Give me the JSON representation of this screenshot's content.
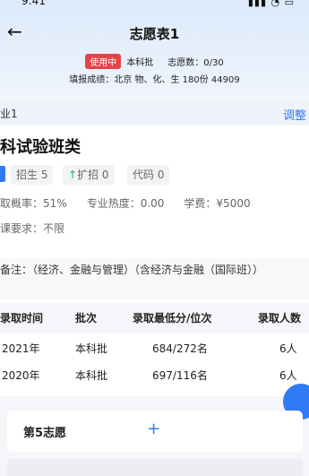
{
  "status": {
    "time": "9:41",
    "icons": "▮▮▮ ◔ ▭"
  },
  "header": {
    "back_icon": "arrow-left-icon",
    "title": "志愿表1",
    "badge": "使用中",
    "batch": "本科批",
    "count_label": "志愿数：0/30",
    "score_line": "填报成绩：北京   物、化、生  180份  44909"
  },
  "card": {
    "crumb": "业1",
    "adjust": "调整",
    "school": "科试验班类",
    "tags": {
      "enroll": "招生 5",
      "expand_arrow": "↑",
      "expand": "扩招 0",
      "code": "代码 0"
    },
    "prob_line": {
      "prob": "取概率：51%",
      "heat": "专业热度：0.00",
      "fee": "学费：¥5000"
    },
    "subject_req": "课要求：不限",
    "remark": "备注：（经济、金融与管理）（含经济与金融（国际班））"
  },
  "table": {
    "headers": [
      "录取时间",
      "批次",
      "录取最低分/位次",
      "录取人数"
    ],
    "rows": [
      [
        "2021年",
        "本科批",
        "684/272名",
        "6人"
      ],
      [
        "2020年",
        "本科批",
        "697/116名",
        "6人"
      ]
    ]
  },
  "next": {
    "label": "第5志愿",
    "add": "+"
  },
  "colors": {
    "accent": "#2f7bf5",
    "badge": "#e8414a",
    "up": "#1cae6e"
  }
}
